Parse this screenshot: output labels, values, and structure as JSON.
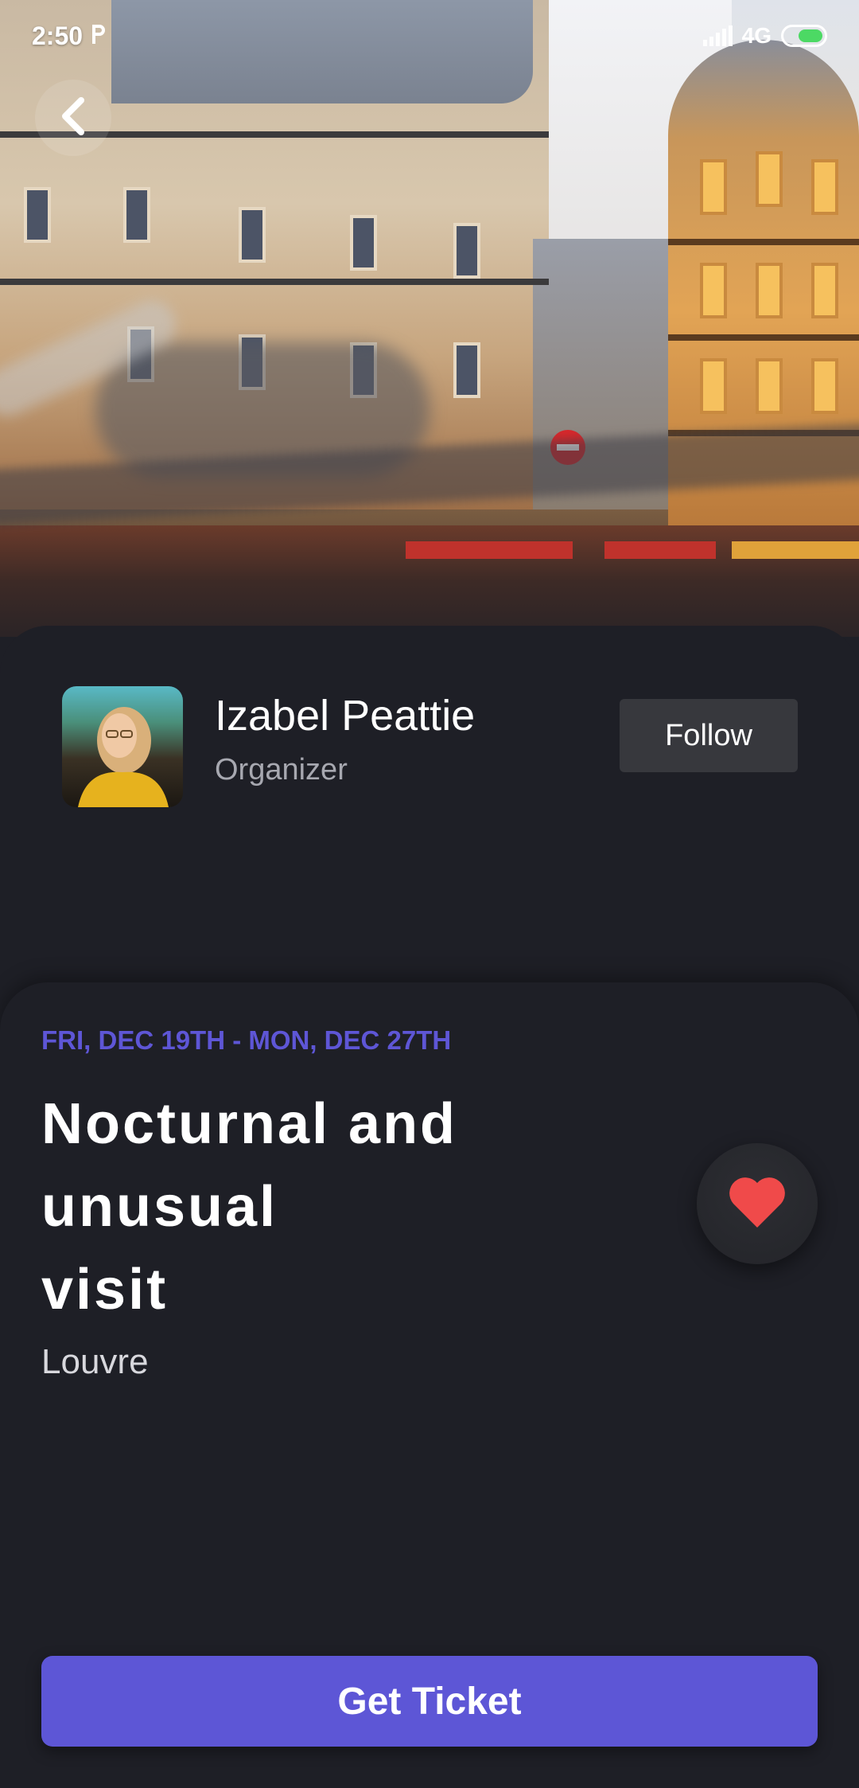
{
  "status_bar": {
    "time": "2:50",
    "carrier_icon": "p-icon",
    "network": "4G",
    "battery_icon": "battery-charging-icon"
  },
  "hero": {
    "back_icon": "chevron-left-icon"
  },
  "organizer": {
    "name": "Izabel Peattie",
    "role": "Organizer",
    "follow_label": "Follow"
  },
  "event": {
    "dates": "FRI, DEC 19TH - MON, DEC 27TH",
    "title": "Nocturnal and\nunusual\nvisit",
    "venue": "Louvre",
    "favorite_icon": "heart-icon"
  },
  "cta": {
    "label": "Get Ticket"
  },
  "colors": {
    "background": "#1e1f26",
    "accent": "#5d56d6",
    "heart": "#f04a4a",
    "follow_bg": "#37383d"
  }
}
